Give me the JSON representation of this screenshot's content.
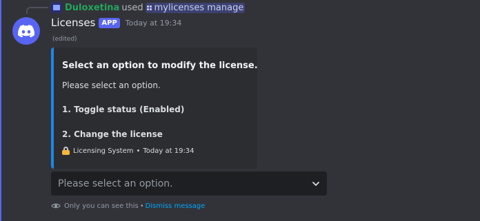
{
  "reply": {
    "username": "Duloxetina",
    "used_text": "used",
    "command": "mylicenses manage",
    "command_icon": "slash-command-icon"
  },
  "message": {
    "bot_name": "Licenses",
    "app_tag": "APP",
    "timestamp": "Today at 19:34",
    "edited_label": "(edited)",
    "accent_color": "#1e88e5"
  },
  "embed": {
    "title": "Select an option to modify the license.",
    "description": "Please select an option.",
    "line1": "1. Toggle status (Enabled)",
    "line2": "2. Change the license",
    "footer_icon": "lock-icon",
    "footer_text": "Licensing System",
    "footer_separator": "•",
    "footer_timestamp": "Today at 19:34"
  },
  "select_menu": {
    "placeholder": "Please select an option.",
    "icon": "chevron-down-icon"
  },
  "ephemeral": {
    "notice": "Only you can see this",
    "separator": "•",
    "dismiss_label": "Dismiss message"
  }
}
